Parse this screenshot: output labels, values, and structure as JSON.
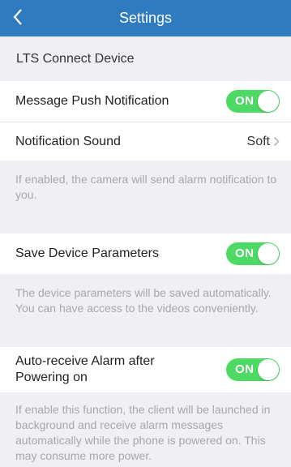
{
  "header": {
    "title": "Settings",
    "back_icon": "chevron-left-icon"
  },
  "device_header": "LTS Connect Device",
  "colors": {
    "accent": "#2f7bbf",
    "toggle_on": "#4cd964",
    "hint_text": "#a8a8a8"
  },
  "message_push": {
    "label": "Message Push Notification",
    "toggle": "ON",
    "enabled": true
  },
  "notification_sound": {
    "label": "Notification Sound",
    "value": "Soft",
    "icon": "chevron-right-icon"
  },
  "message_push_desc": "If enabled, the camera will send alarm notification to you.",
  "save_params": {
    "label": "Save Device Parameters",
    "toggle": "ON",
    "enabled": true
  },
  "save_params_desc": "The device parameters will be saved automatically. You can have access to the videos conveniently.",
  "auto_receive": {
    "label": "Auto-receive Alarm after Powering on",
    "toggle": "ON",
    "enabled": true
  },
  "auto_receive_desc": "If enable this function, the client will be launched in background and receive alarm messages automatically while the phone is powered on. This may consume more power."
}
